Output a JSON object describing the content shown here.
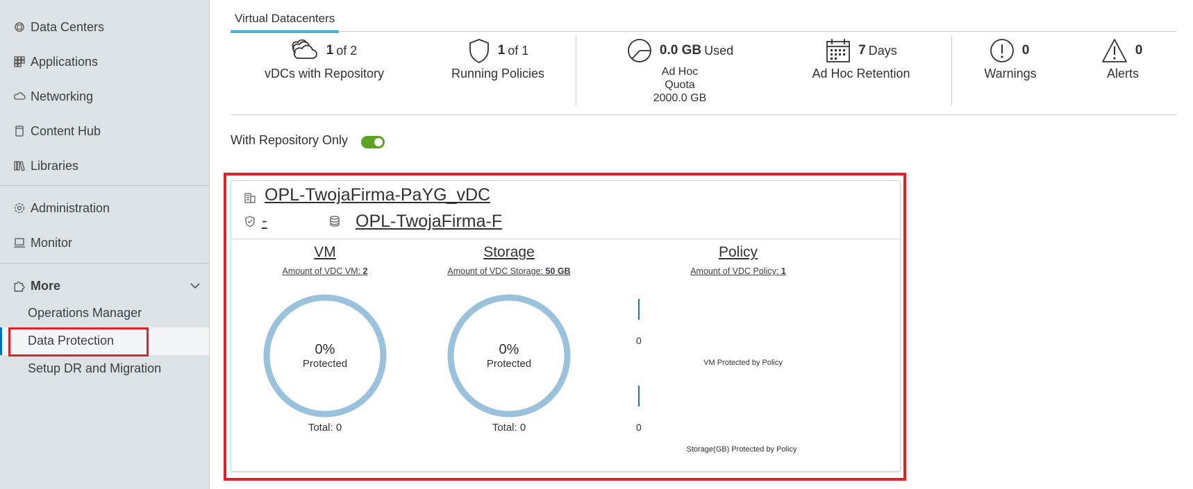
{
  "sidebar": {
    "items": [
      {
        "label": "Data Centers",
        "icon": "datacenter-icon"
      },
      {
        "label": "Applications",
        "icon": "applications-icon"
      },
      {
        "label": "Networking",
        "icon": "cloud-network-icon"
      },
      {
        "label": "Content Hub",
        "icon": "content-hub-icon"
      },
      {
        "label": "Libraries",
        "icon": "libraries-icon"
      },
      {
        "label": "Administration",
        "icon": "gear-icon"
      },
      {
        "label": "Monitor",
        "icon": "monitor-icon"
      }
    ],
    "more_label": "More",
    "more_items": [
      "Operations Manager",
      "Data Protection",
      "Setup DR and Migration"
    ],
    "active_item": "Data Protection"
  },
  "tab": {
    "label": "Virtual Datacenters"
  },
  "stats": {
    "vdcs": {
      "num": "1",
      "of": "of 2",
      "label": "vDCs with Repository"
    },
    "policies": {
      "num": "1",
      "of": "of 1",
      "label": "Running Policies"
    },
    "used": {
      "num": "0.0 GB",
      "of": "Used",
      "label1": "Ad Hoc",
      "label2": "Quota",
      "label3": "2000.0 GB"
    },
    "retention": {
      "num": "7",
      "of": "Days",
      "label": "Ad Hoc Retention"
    },
    "warnings": {
      "num": "0",
      "label": "Warnings"
    },
    "alerts": {
      "num": "0",
      "label": "Alerts"
    }
  },
  "filter": {
    "label": "With Repository Only",
    "toggle_on": true
  },
  "card": {
    "title": "OPL-TwojaFirma-PaYG_vDC",
    "policy_link": "-",
    "repository_link": "OPL-TwojaFirma-F",
    "vm": {
      "title": "VM",
      "sub_prefix": "Amount of VDC VM:",
      "sub_value": "2",
      "percent": "0%",
      "percent_label": "Protected",
      "total": "Total: 0"
    },
    "storage": {
      "title": "Storage",
      "sub_prefix": "Amount of VDC Storage:",
      "sub_value": "50 GB",
      "percent": "0%",
      "percent_label": "Protected",
      "total": "Total: 0"
    },
    "policy": {
      "title": "Policy",
      "sub_prefix": "Amount of VDC Policy:",
      "sub_value": "1",
      "bars": [
        {
          "value": "0",
          "label": "VM Protected by Policy"
        },
        {
          "value": "0",
          "label": "Storage(GB) Protected by Policy"
        }
      ]
    }
  },
  "colors": {
    "accent": "#0072a3",
    "highlight": "#e0202a",
    "toggle": "#5aa220",
    "donut": "#9ac2dd"
  }
}
